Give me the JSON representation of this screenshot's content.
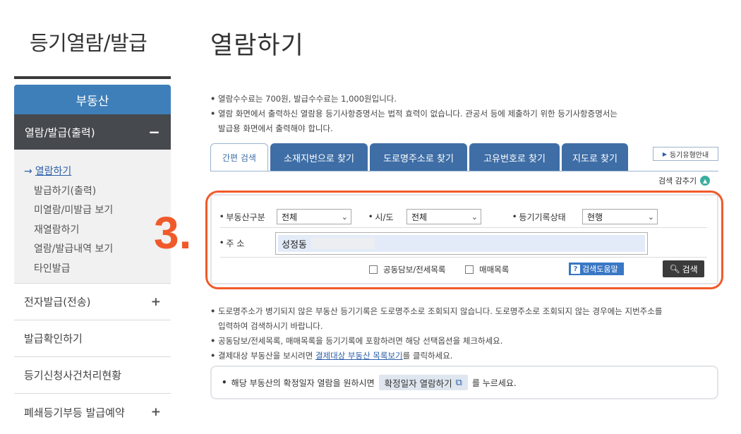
{
  "sidebar": {
    "title": "등기열람/발급",
    "category": "부동산",
    "active_menu": {
      "label": "열람/발급(출력)",
      "toggle": "−"
    },
    "submenu": [
      {
        "label": "열람하기",
        "arrow": "→"
      },
      {
        "label": "발급하기(출력)"
      },
      {
        "label": "미열람/미발급 보기"
      },
      {
        "label": "재열람하기"
      },
      {
        "label": "열람/발급내역 보기"
      },
      {
        "label": "타인발급"
      }
    ],
    "menu": [
      {
        "label": "전자발급(전송)",
        "toggle": "+"
      },
      {
        "label": "발급확인하기",
        "toggle": ""
      },
      {
        "label": "등기신청사건처리현황",
        "toggle": ""
      },
      {
        "label": "폐쇄등기부등 발급예약",
        "toggle": "+"
      }
    ]
  },
  "main": {
    "title": "열람하기",
    "notes_top": [
      "열람수수료는 700원, 발급수수료는 1,000원입니다.",
      "열람 화면에서 출력하신 열람용 등기사항증명서는 법적 효력이 없습니다. 관공서 등에 제출하기 위한 등기사항증명서는",
      "발급용 화면에서 출력해야 합니다."
    ],
    "bullet": "•",
    "tabs": [
      "간편 검색",
      "소재지번으로 찾기",
      "도로명주소로 찾기",
      "고유번호로 찾기",
      "지도로 찾기"
    ],
    "guide_button": "등기유형안내",
    "collapse_label": "검색 감추기",
    "annotation_number": "3.",
    "form": {
      "property_type_label": "부동산구분",
      "property_type_value": "전체",
      "sido_label": "시/도",
      "sido_value": "전체",
      "record_status_label": "등기기록상태",
      "record_status_value": "현행",
      "address_label": "주 소",
      "address_value": "성정동",
      "check1": "공동담보/전세목록",
      "check2": "매매목록",
      "help_button": "검색도움말",
      "search_button": "검색"
    },
    "notes_bottom": {
      "line1": "도로명주소가 병기되지 않은 부동산 등기기록은 도로명주소로 조회되지 않습니다. 도로명주소로 조회되지 않는 경우에는 지번주소를",
      "line1b": "입력하여 검색하시기 바랍니다.",
      "line2": "공동담보/전세목록, 매매목록을 등기기록에 포함하려면 해당 선택옵션을 체크하세요.",
      "line3_pre": "결제대상 부동산을 보시려면 ",
      "line3_link": "결제대상 부동산 목록보기",
      "line3_post": "를 클릭하세요."
    },
    "info": {
      "pre": "해당 부동산의 확정일자 열람을 원하시면",
      "button": "확정일자 열람하기",
      "post": "를 누르세요."
    }
  },
  "colors": {
    "category_blue": "#3f7fb9",
    "tab_blue": "#3f6ea6",
    "active_menu_bg": "#46494e",
    "annotation_orange": "#f05a2a",
    "search_btn": "#3b3b3b"
  }
}
